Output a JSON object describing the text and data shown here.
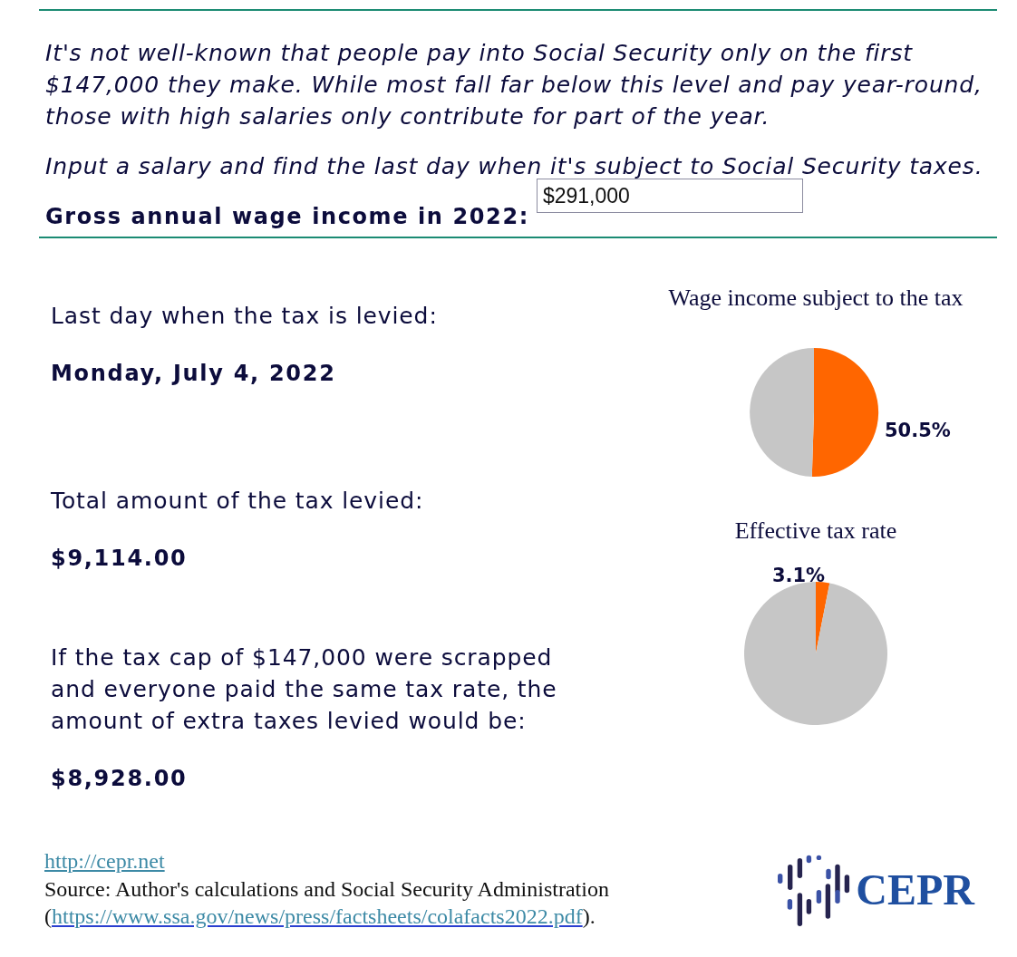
{
  "intro": {
    "paragraphs": [
      "It's not well-known that people pay into Social Security only on the first $147,000 they make. While most fall far below this level and pay year-round, those with high salaries only contribute for part of the year.",
      "Input a salary and find the last day when it's subject to Social Security taxes."
    ]
  },
  "wage_input": {
    "label": "Gross annual wage income in 2022:",
    "value": "$291,000"
  },
  "results": [
    {
      "label": "Last day when the tax is levied:",
      "value": "Monday, July 4, 2022"
    },
    {
      "label": "Total amount of the tax levied:",
      "value": "$9,114.00"
    },
    {
      "label": "If the tax cap of $147,000 were scrapped and everyone paid the same tax rate, the amount of extra taxes levied would be:",
      "value": "$8,928.00"
    }
  ],
  "charts": [
    {
      "chart_data": {
        "type": "pie",
        "title": "Wage income subject to the tax",
        "values": [
          50.5,
          49.5
        ],
        "colors": [
          "#ff6600",
          "#c6c6c6"
        ],
        "value_labels": [
          "50.5%",
          null
        ]
      }
    },
    {
      "chart_data": {
        "type": "pie",
        "title": "Effective tax rate",
        "values": [
          3.1,
          96.9
        ],
        "colors": [
          "#ff6600",
          "#c6c6c6"
        ],
        "value_labels": [
          "3.1%",
          null
        ]
      }
    }
  ],
  "footer": {
    "link": "http://cepr.net",
    "source": {
      "text_before": "Source: Author's calculations and Social Security Administration (",
      "link": "https://www.ssa.gov/news/press/factsheets/colafacts2022.pdf",
      "text_after": ")."
    },
    "logo": {
      "text": "CEPR"
    }
  }
}
